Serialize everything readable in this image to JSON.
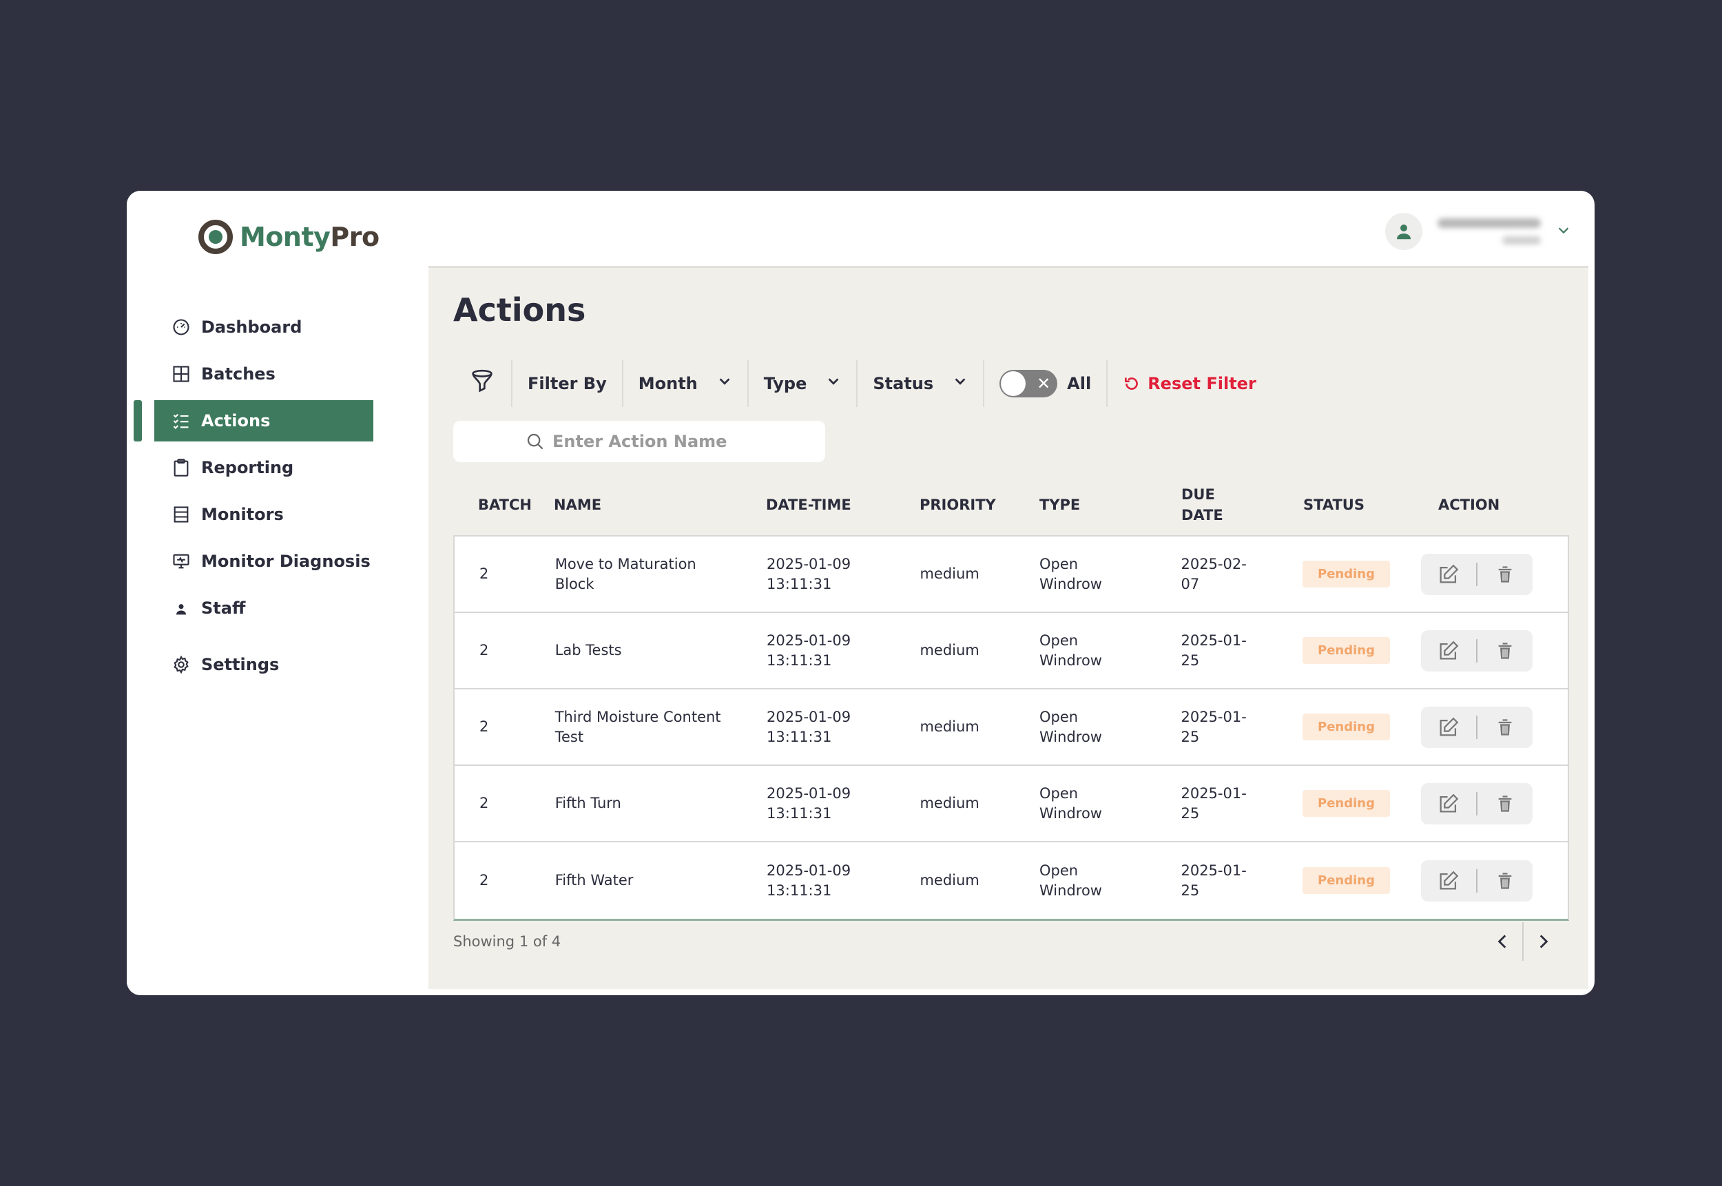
{
  "app": {
    "brand_part1": "Monty",
    "brand_part2": "Pro"
  },
  "colors": {
    "accent": "#3e7a5e",
    "danger": "#e0203a",
    "pending_bg": "#fdebdc",
    "pending_text": "#f2a66b",
    "frame_bg": "#2f3141"
  },
  "sidebar": {
    "items": [
      {
        "label": "Dashboard",
        "icon": "gauge-icon"
      },
      {
        "label": "Batches",
        "icon": "grid-icon"
      },
      {
        "label": "Actions",
        "icon": "checklist-icon",
        "active": true
      },
      {
        "label": "Reporting",
        "icon": "clipboard-icon"
      },
      {
        "label": "Monitors",
        "icon": "list-box-icon"
      },
      {
        "label": "Monitor Diagnosis",
        "icon": "monitor-icon"
      },
      {
        "label": "Staff",
        "icon": "person-icon"
      },
      {
        "label": "Settings",
        "icon": "gear-icon"
      }
    ]
  },
  "header": {
    "user_icon": "user-icon",
    "dropdown_icon": "chevron-down-icon"
  },
  "main": {
    "title": "Actions",
    "filters": {
      "filter_by": "Filter By",
      "month": "Month",
      "type": "Type",
      "status": "Status",
      "toggle_label": "All",
      "reset": "Reset Filter"
    },
    "search": {
      "placeholder": "Enter Action Name"
    },
    "table": {
      "headers": {
        "batch": "BATCH",
        "name": "NAME",
        "datetime": "DATE-TIME",
        "priority": "PRIORITY",
        "type": "TYPE",
        "due_line1": "DUE",
        "due_line2": "DATE",
        "status": "STATUS",
        "action": "ACTION"
      },
      "rows": [
        {
          "batch": "2",
          "name": "Move to Maturation Block",
          "date": "2025-01-09",
          "time": "13:11:31",
          "priority": "medium",
          "type1": "Open",
          "type2": "Windrow",
          "due1": "2025-02-",
          "due2": "07",
          "status": "Pending"
        },
        {
          "batch": "2",
          "name": "Lab Tests",
          "date": "2025-01-09",
          "time": "13:11:31",
          "priority": "medium",
          "type1": "Open",
          "type2": "Windrow",
          "due1": "2025-01-",
          "due2": "25",
          "status": "Pending"
        },
        {
          "batch": "2",
          "name": "Third Moisture Content Test",
          "date": "2025-01-09",
          "time": "13:11:31",
          "priority": "medium",
          "type1": "Open",
          "type2": "Windrow",
          "due1": "2025-01-",
          "due2": "25",
          "status": "Pending"
        },
        {
          "batch": "2",
          "name": "Fifth Turn",
          "date": "2025-01-09",
          "time": "13:11:31",
          "priority": "medium",
          "type1": "Open",
          "type2": "Windrow",
          "due1": "2025-01-",
          "due2": "25",
          "status": "Pending"
        },
        {
          "batch": "2",
          "name": "Fifth Water",
          "date": "2025-01-09",
          "time": "13:11:31",
          "priority": "medium",
          "type1": "Open",
          "type2": "Windrow",
          "due1": "2025-01-",
          "due2": "25",
          "status": "Pending"
        }
      ]
    },
    "footer": {
      "showing": "Showing 1 of 4"
    }
  }
}
